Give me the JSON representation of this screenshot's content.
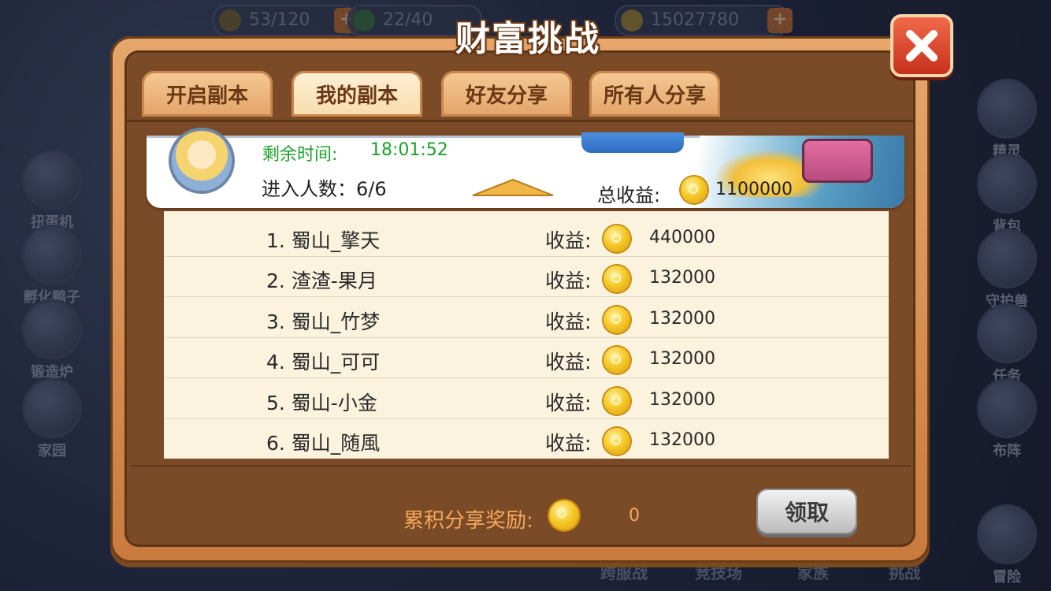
{
  "background": {
    "hud": [
      {
        "label": "53/120"
      },
      {
        "label": "22/40"
      },
      {
        "label": "15027780"
      }
    ],
    "left_menu": [
      "扭蛋机",
      "孵化鸭子",
      "锻造炉",
      "家园"
    ],
    "right_menu": [
      "精灵",
      "背包",
      "守护兽",
      "任务",
      "布阵",
      "冒险"
    ],
    "bottom_menu": [
      "跨服战",
      "竞技场",
      "家族",
      "挑战"
    ]
  },
  "modal": {
    "title": "财富挑战",
    "tabs": [
      "开启副本",
      "我的副本",
      "好友分享",
      "所有人分享"
    ],
    "active_tab": 1,
    "info": {
      "timer_label": "剩余时间:",
      "timer_value": "18:01:52",
      "players_text": "进入人数：6/6",
      "total_label": "总收益:",
      "total_value": "1100000"
    },
    "rows": [
      {
        "name": "1. 蜀山_擎天",
        "revenue_label": "收益:",
        "revenue": "440000"
      },
      {
        "name": "2. 渣渣-果月",
        "revenue_label": "收益:",
        "revenue": "132000"
      },
      {
        "name": "3. 蜀山_竹梦",
        "revenue_label": "收益:",
        "revenue": "132000"
      },
      {
        "name": "4. 蜀山_可可",
        "revenue_label": "收益:",
        "revenue": "132000"
      },
      {
        "name": "5. 蜀山-小金",
        "revenue_label": "收益:",
        "revenue": "132000"
      },
      {
        "name": "6. 蜀山_随風",
        "revenue_label": "收益:",
        "revenue": "132000"
      }
    ],
    "reward_label": "累积分享奖励:",
    "reward_value": "0",
    "claim_button": "领取"
  },
  "colors": {
    "accent_orange": "#f2a85a",
    "timer_green": "#1ea02a",
    "panel_brown": "#7b4a26",
    "close_red": "#c7301c"
  }
}
